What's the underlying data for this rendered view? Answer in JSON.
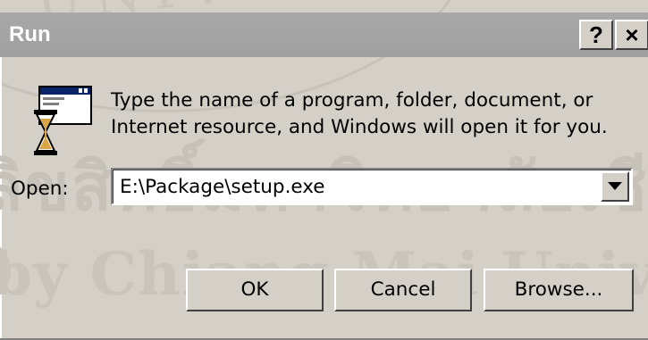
{
  "window": {
    "title": "Run",
    "help_button": "?",
    "close_button": "×"
  },
  "dialog": {
    "description_line1": "Type the name of a program, folder, document, or",
    "description_line2": "Internet resource, and Windows will open it for you.",
    "open_label": "Open:",
    "open_value": "E:\\Package\\setup.exe",
    "app_icon": "run-program-icon",
    "dropdown_icon": "dropdown-arrow-icon"
  },
  "buttons": {
    "ok": "OK",
    "cancel": "Cancel",
    "browse": "Browse..."
  },
  "watermark": {
    "seal_text": "UNIVE",
    "thai_text": "ลิขสิทธิ์มหาวิทยาลัยเชียงใหม่",
    "copyright_text": "by Chiang Mai Univer"
  },
  "colors": {
    "face": "#d4d0c8",
    "titlebar_inactive": "#a0a0a0",
    "title_text": "#ffffff",
    "field_bg": "#ffffff"
  }
}
